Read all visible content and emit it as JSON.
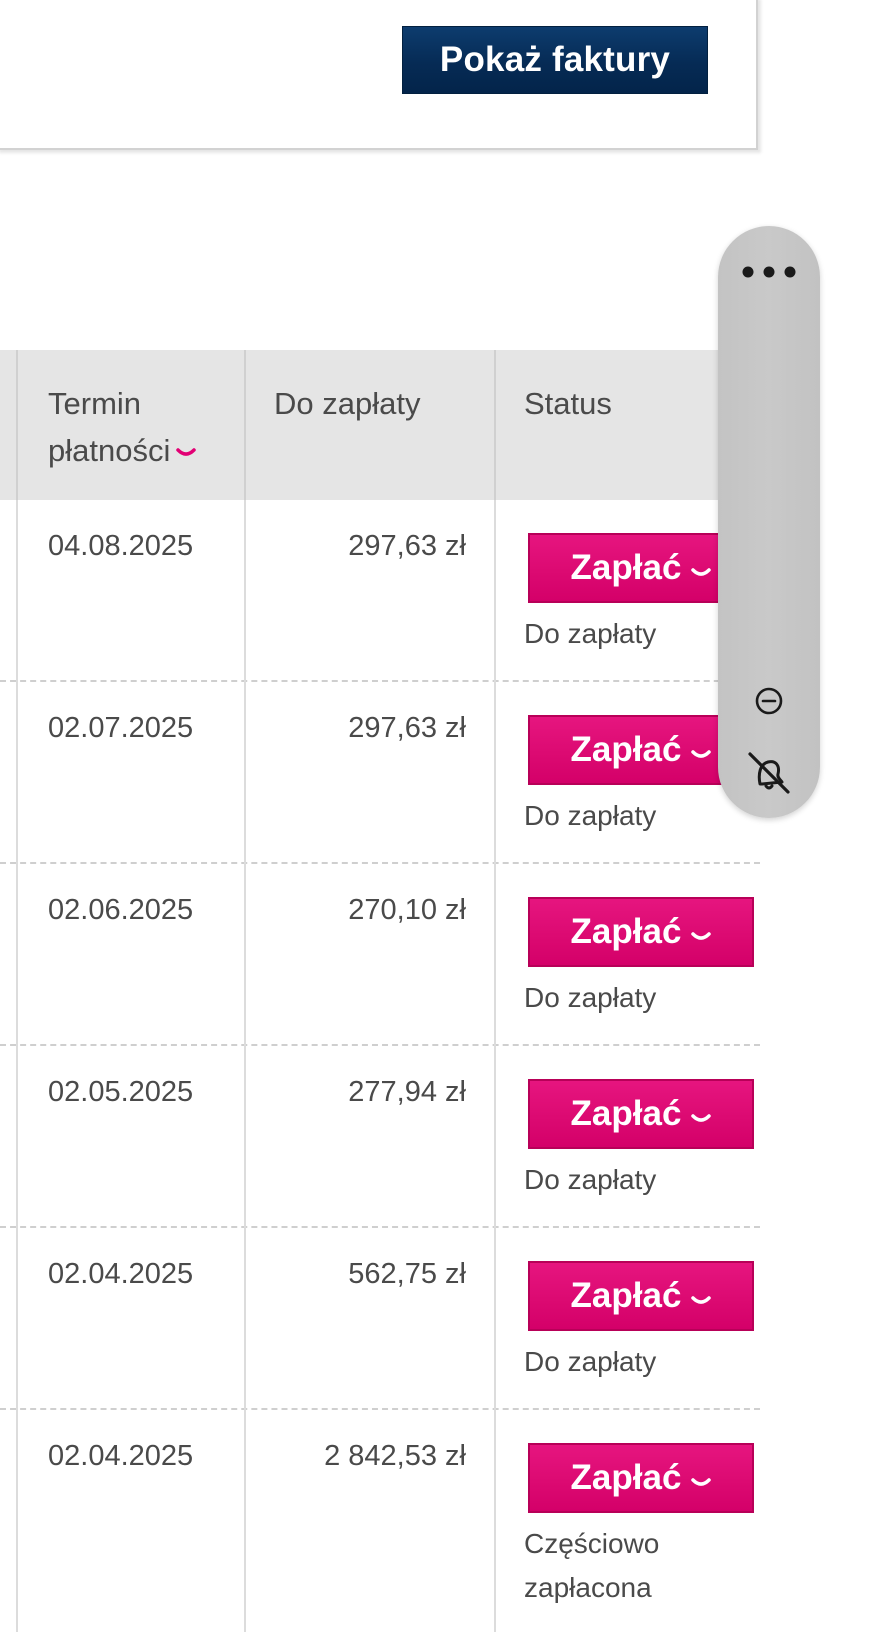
{
  "filter_panel": {
    "show_invoices_label": "Pokaż faktury"
  },
  "table": {
    "headers": {
      "due_date_line1": "Termin",
      "due_date_line2": "płatności",
      "amount_due": "Do zapłaty",
      "status": "Status"
    },
    "pay_button_label": "Zapłać",
    "rows": [
      {
        "due_date": "04.08.2025",
        "amount": "297,63 zł",
        "status_line1": "Do zapłaty",
        "status_line2": ""
      },
      {
        "due_date": "02.07.2025",
        "amount": "297,63 zł",
        "status_line1": "Do zapłaty",
        "status_line2": ""
      },
      {
        "due_date": "02.06.2025",
        "amount": "270,10 zł",
        "status_line1": "Do zapłaty",
        "status_line2": ""
      },
      {
        "due_date": "02.05.2025",
        "amount": "277,94 zł",
        "status_line1": "Do zapłaty",
        "status_line2": ""
      },
      {
        "due_date": "02.04.2025",
        "amount": "562,75 zł",
        "status_line1": "Do zapłaty",
        "status_line2": ""
      },
      {
        "due_date": "02.04.2025",
        "amount": "2 842,53 zł",
        "status_line1": "Częściowo",
        "status_line2": "zapłacona"
      }
    ]
  },
  "floating_widget": {
    "icons": [
      "more-horizontal-icon",
      "minus-circle-icon",
      "bell-off-icon"
    ]
  },
  "colors": {
    "primary_navy": "#062b55",
    "pay_magenta": "#dc0a72",
    "header_gray": "#e5e5e5",
    "widget_gray": "#c6c6c6"
  }
}
